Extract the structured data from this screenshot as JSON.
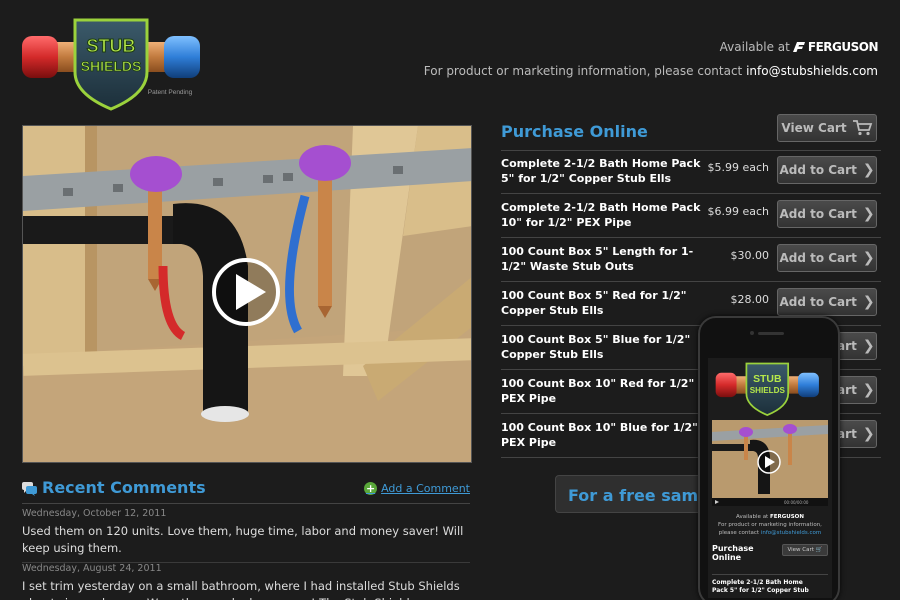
{
  "header": {
    "logo_text_line1": "STUB",
    "logo_text_line2": "SHIELDS",
    "patent": "Patent Pending",
    "available_label": "Available at",
    "retailer": "FERGUSON",
    "contact_prefix": "For product or marketing information, please contact",
    "contact_email": "info@stubshields.com"
  },
  "video": {
    "icon": "play-icon"
  },
  "comments": {
    "title": "Recent Comments",
    "add_label": "Add a Comment",
    "items": [
      {
        "date": "Wednesday, October 12, 2011",
        "text": "Used them on 120 units. Love them, huge time, labor and money saver! Will keep using them."
      },
      {
        "date": "Wednesday, August 24, 2011",
        "text": "I set trim yesterday on a small bathroom, where I had installed Stub Shields about six weeks ago. Wow, they worked awesome! The Stub Shields were covered with drywall"
      }
    ]
  },
  "purchase": {
    "title": "Purchase Online",
    "view_cart_label": "View Cart",
    "add_label": "Add to Cart",
    "products": [
      {
        "name": "Complete 2-1/2 Bath Home Pack 5\" for 1/2\" Copper Stub Ells",
        "price": "$5.99 each"
      },
      {
        "name": "Complete 2-1/2 Bath Home Pack 10\" for 1/2\" PEX Pipe",
        "price": "$6.99 each"
      },
      {
        "name": "100 Count Box 5\" Length for 1-1/2\" Waste Stub Outs",
        "price": "$30.00"
      },
      {
        "name": "100 Count Box 5\" Red for 1/2\" Copper Stub Ells",
        "price": "$28.00"
      },
      {
        "name": "100 Count Box 5\" Blue for 1/2\" Copper Stub Ells",
        "price": ""
      },
      {
        "name": "100 Count Box 10\" Red for 1/2\" PEX Pipe",
        "price": ""
      },
      {
        "name": "100 Count Box 10\" Blue for 1/2\" PEX Pipe",
        "price": ""
      }
    ],
    "free_sample": "For a free samp"
  },
  "phone": {
    "available_label": "Available at",
    "retailer": "FERGUSON",
    "contact_line1": "For product or marketing information,",
    "contact_line2_prefix": "please contact",
    "contact_email": "info@stubshields.com",
    "purchase_title_line1": "Purchase",
    "purchase_title_line2": "Online",
    "view_cart_label": "View Cart",
    "product_line1": "Complete 2-1/2 Bath Home",
    "product_line2": "Pack 5\" for 1/2\" Copper Stub",
    "video_time": "00:00/00:00"
  },
  "colors": {
    "accent_blue": "#3f9ad6",
    "background": "#1c1c1c",
    "shield_green": "#9bd23c",
    "cap_red": "#d42a2a",
    "cap_blue": "#2f7ed8",
    "plus_green": "#5aa83a"
  }
}
